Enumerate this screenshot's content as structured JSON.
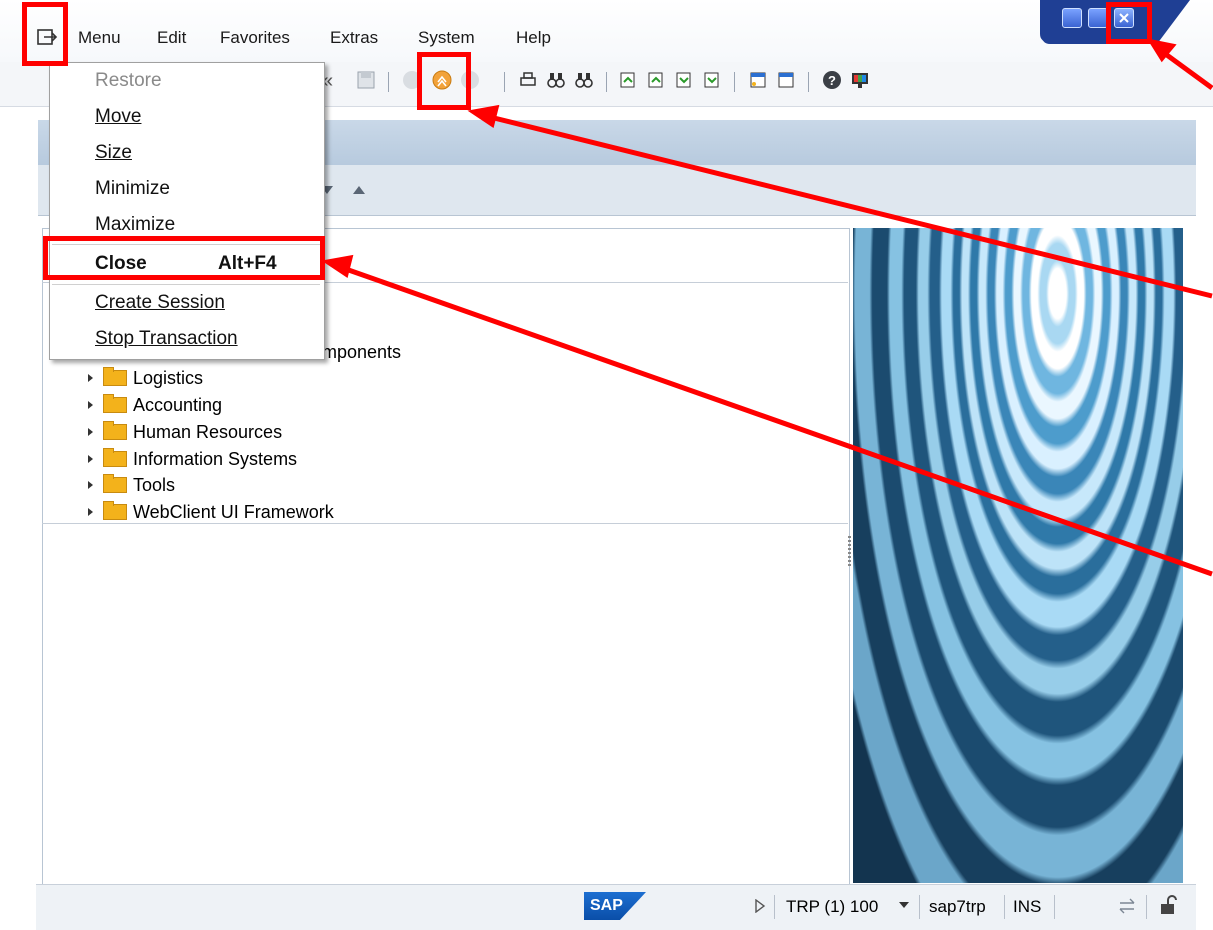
{
  "menubar": {
    "items": [
      {
        "label": "Menu",
        "id": "menu"
      },
      {
        "label": "Edit",
        "id": "edit"
      },
      {
        "label": "Favorites",
        "id": "favorites"
      },
      {
        "label": "Extras",
        "id": "extras"
      },
      {
        "label": "System",
        "id": "system"
      },
      {
        "label": "Help",
        "id": "help"
      }
    ]
  },
  "dropdown": {
    "restore": "Restore",
    "move": "Move",
    "size": "Size",
    "minimize": "Minimize",
    "maximize": "Maximize",
    "close": "Close",
    "close_shortcut": "Alt+F4",
    "create_session": "Create Session",
    "stop_transaction": "Stop Transaction"
  },
  "tree": {
    "partial_item": "mponents",
    "items": [
      "Logistics",
      "Accounting",
      "Human Resources",
      "Information Systems",
      "Tools",
      "WebClient UI Framework"
    ]
  },
  "statusbar": {
    "logo": "SAP",
    "system": "TRP (1) 100",
    "server": "sap7trp",
    "mode": "INS"
  },
  "colors": {
    "annotation": "#ff0000",
    "folder": "#f3b21b",
    "window_controls": "#1f3f94"
  }
}
